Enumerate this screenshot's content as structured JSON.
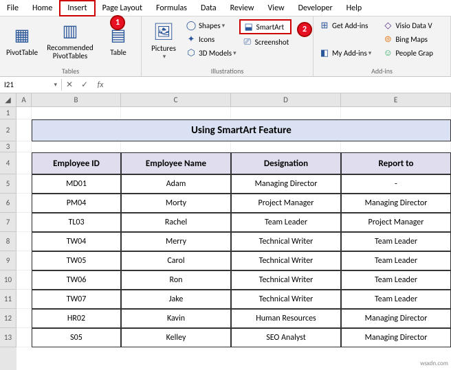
{
  "menu": {
    "items": [
      "File",
      "Home",
      "Insert",
      "Page Layout",
      "Formulas",
      "Data",
      "Review",
      "View",
      "Developer",
      "Help"
    ],
    "active_index": 2
  },
  "ribbon": {
    "tables": {
      "label": "Tables",
      "pivottable": "PivotTable",
      "recommended": "Recommended\nPivotTables",
      "table": "Table"
    },
    "illustrations": {
      "label": "Illustrations",
      "pictures": "Pictures",
      "shapes": "Shapes",
      "icons": "Icons",
      "models": "3D Models",
      "smartart": "SmartArt",
      "screenshot": "Screenshot"
    },
    "addins": {
      "label": "Add-ins",
      "get": "Get Add-ins",
      "my": "My Add-ins",
      "visio": "Visio Data V",
      "bing": "Bing Maps",
      "people": "People Grap"
    }
  },
  "callouts": {
    "one": "1",
    "two": "2"
  },
  "namebox": "I21",
  "fx": "fx",
  "col_headers": [
    "A",
    "B",
    "C",
    "D",
    "E"
  ],
  "row_headers": [
    "1",
    "2",
    "3",
    "4",
    "5",
    "6",
    "7",
    "8",
    "9",
    "10",
    "11",
    "12",
    "13"
  ],
  "title": "Using SmartArt Feature",
  "table": {
    "headers": [
      "Employee ID",
      "Employee Name",
      "Designation",
      "Report to"
    ],
    "rows": [
      [
        "MD01",
        "Adam",
        "Managing Director",
        "-"
      ],
      [
        "PM04",
        "Morty",
        "Project Manager",
        "Managing Director"
      ],
      [
        "TL03",
        "Rachel",
        "Team Leader",
        "Project Manager"
      ],
      [
        "TW04",
        "Merry",
        "Technical Writer",
        "Team Leader"
      ],
      [
        "TW05",
        "Carol",
        "Technical Writer",
        "Team Leader"
      ],
      [
        "TW06",
        "Ron",
        "Technical Writer",
        "Team Leader"
      ],
      [
        "TW07",
        "Jake",
        "Technical Writer",
        "Team Leader"
      ],
      [
        "HR02",
        "Kavin",
        "Human Resources",
        "Managing Director"
      ],
      [
        "S05",
        "Kelley",
        "SEO Analyst",
        "Managing Director"
      ]
    ]
  },
  "watermark": "wsxdn.com"
}
